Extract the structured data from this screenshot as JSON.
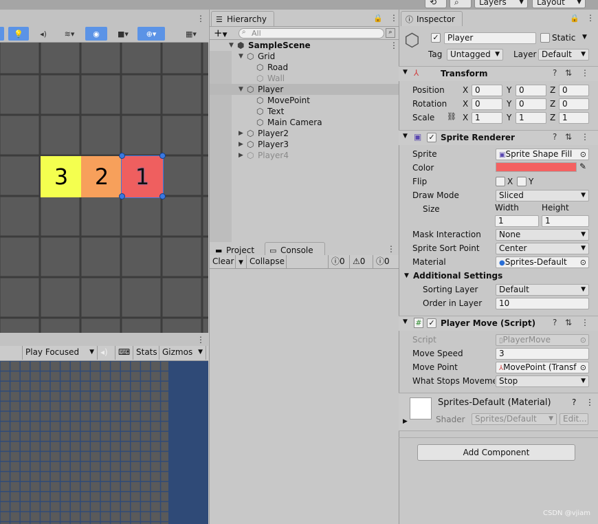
{
  "top_bar": {
    "layers_label": "Layers",
    "layout_label": "Layout"
  },
  "game": {
    "play_mode": "Play Focused",
    "stats": "Stats",
    "gizmos": "Gizmos"
  },
  "scene": {
    "tiles": [
      {
        "label": "3",
        "color": "#f4ff4f"
      },
      {
        "label": "2",
        "color": "#f7a05b"
      },
      {
        "label": "1",
        "color": "#ef5f5f"
      }
    ]
  },
  "hierarchy": {
    "tab": "Hierarchy",
    "search_placeholder": "All",
    "items": [
      {
        "label": "SampleScene",
        "type": "scene",
        "expanded": true,
        "dim": false,
        "selected": false
      },
      {
        "label": "Grid",
        "type": "gameobject",
        "expanded": true,
        "dim": false,
        "selected": false
      },
      {
        "label": "Road",
        "type": "gameobject",
        "expanded": null,
        "dim": false,
        "selected": false
      },
      {
        "label": "Wall",
        "type": "gameobject",
        "expanded": null,
        "dim": true,
        "selected": false
      },
      {
        "label": "Player",
        "type": "gameobject",
        "expanded": true,
        "dim": false,
        "selected": true
      },
      {
        "label": "MovePoint",
        "type": "gameobject",
        "expanded": null,
        "dim": false,
        "selected": false
      },
      {
        "label": "Text",
        "type": "gameobject",
        "expanded": null,
        "dim": false,
        "selected": false
      },
      {
        "label": "Main Camera",
        "type": "gameobject",
        "expanded": null,
        "dim": false,
        "selected": false
      },
      {
        "label": "Player2",
        "type": "gameobject",
        "expanded": false,
        "dim": false,
        "selected": false
      },
      {
        "label": "Player3",
        "type": "gameobject",
        "expanded": false,
        "dim": false,
        "selected": false
      },
      {
        "label": "Player4",
        "type": "gameobject",
        "expanded": false,
        "dim": true,
        "selected": false
      }
    ]
  },
  "console": {
    "tab_project": "Project",
    "tab_console": "Console",
    "clear": "Clear",
    "collapse": "Collapse",
    "errors": "0",
    "warnings": "0",
    "logs": "0"
  },
  "inspector": {
    "tab": "Inspector",
    "object_name": "Player",
    "static_label": "Static",
    "tag_label": "Tag",
    "tag_value": "Untagged",
    "layer_label": "Layer",
    "layer_value": "Default",
    "transform": {
      "title": "Transform",
      "position_label": "Position",
      "position": {
        "x": "0",
        "y": "0",
        "z": "0"
      },
      "rotation_label": "Rotation",
      "rotation": {
        "x": "0",
        "y": "0",
        "z": "0"
      },
      "scale_label": "Scale",
      "scale": {
        "x": "1",
        "y": "1",
        "z": "1"
      }
    },
    "sprite_renderer": {
      "title": "Sprite Renderer",
      "sprite_label": "Sprite",
      "sprite_value": "Sprite Shape Fill",
      "color_label": "Color",
      "color_value": "#f46161",
      "flip_label": "Flip",
      "flip_x": "X",
      "flip_y": "Y",
      "draw_mode_label": "Draw Mode",
      "draw_mode_value": "Sliced",
      "size_label": "Size",
      "width_label": "Width",
      "height_label": "Height",
      "width_value": "1",
      "height_value": "1",
      "mask_label": "Mask Interaction",
      "mask_value": "None",
      "sort_point_label": "Sprite Sort Point",
      "sort_point_value": "Center",
      "material_label": "Material",
      "material_value": "Sprites-Default",
      "additional_label": "Additional Settings",
      "sorting_layer_label": "Sorting Layer",
      "sorting_layer_value": "Default",
      "order_label": "Order in Layer",
      "order_value": "10"
    },
    "player_move": {
      "title": "Player Move (Script)",
      "script_label": "Script",
      "script_value": "PlayerMove",
      "speed_label": "Move Speed",
      "speed_value": "3",
      "movepoint_label": "Move Point",
      "movepoint_value": "MovePoint (Transf",
      "stops_label": "What Stops Movemer",
      "stops_value": "Stop"
    },
    "material": {
      "title": "Sprites-Default (Material)",
      "shader_label": "Shader",
      "shader_value": "Sprites/Default",
      "edit_label": "Edit..."
    },
    "add_component": "Add Component"
  },
  "watermark": "CSDN @vjiam"
}
